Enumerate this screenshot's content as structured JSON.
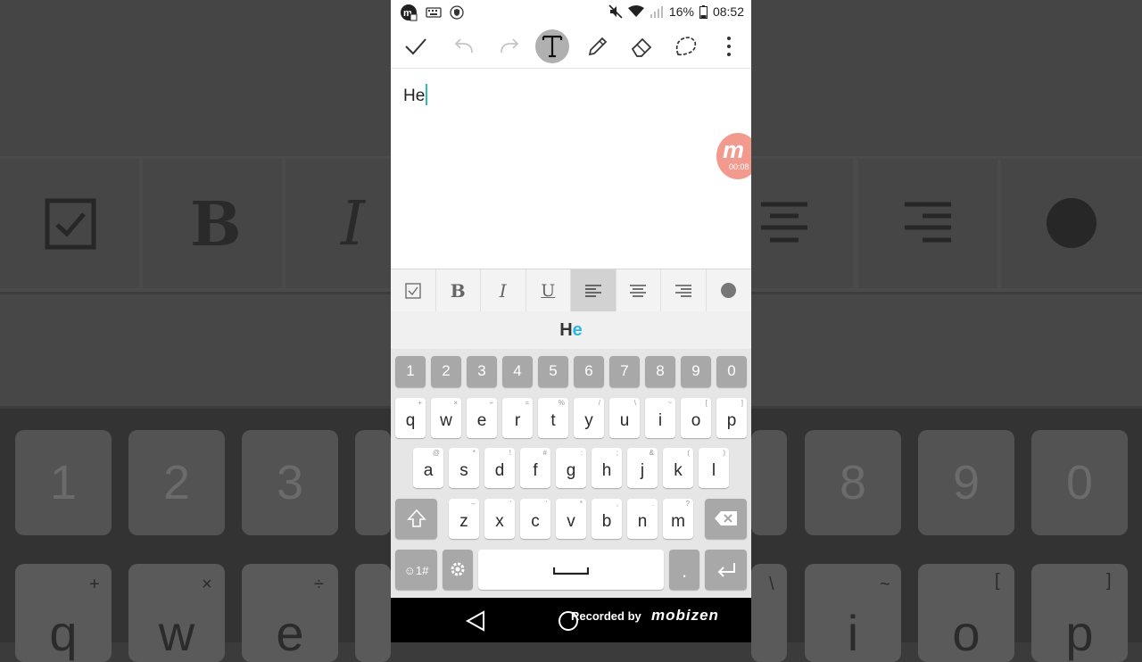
{
  "status_bar": {
    "battery": "16%",
    "time": "08:52"
  },
  "editor": {
    "text": "He"
  },
  "recorder_badge": {
    "logo_letter": "m",
    "timer": "00:08"
  },
  "format_bar": {
    "items": [
      "checkbox",
      "bold",
      "italic",
      "underline",
      "align-left",
      "align-center",
      "align-right",
      "color"
    ],
    "bold_label": "B",
    "italic_label": "I",
    "underline_label": "U",
    "selected": "align-left"
  },
  "suggestion": {
    "prefix": "H",
    "highlight": "e"
  },
  "keyboard": {
    "numbers": [
      "1",
      "2",
      "3",
      "4",
      "5",
      "6",
      "7",
      "8",
      "9",
      "0"
    ],
    "row1": [
      {
        "k": "q",
        "h": "+"
      },
      {
        "k": "w",
        "h": "×"
      },
      {
        "k": "e",
        "h": "÷"
      },
      {
        "k": "r",
        "h": "="
      },
      {
        "k": "t",
        "h": "%"
      },
      {
        "k": "y",
        "h": "/"
      },
      {
        "k": "u",
        "h": "\\"
      },
      {
        "k": "i",
        "h": "~"
      },
      {
        "k": "o",
        "h": "["
      },
      {
        "k": "p",
        "h": "]"
      }
    ],
    "row2": [
      {
        "k": "a",
        "h": "@"
      },
      {
        "k": "s",
        "h": "*"
      },
      {
        "k": "d",
        "h": "!"
      },
      {
        "k": "f",
        "h": "#"
      },
      {
        "k": "g",
        "h": ":"
      },
      {
        "k": "h",
        "h": ";"
      },
      {
        "k": "j",
        "h": "&"
      },
      {
        "k": "k",
        "h": "("
      },
      {
        "k": "l",
        "h": ")"
      }
    ],
    "row3": [
      {
        "k": "z",
        "h": "–"
      },
      {
        "k": "x",
        "h": "'"
      },
      {
        "k": "c",
        "h": "'"
      },
      {
        "k": "v",
        "h": "*"
      },
      {
        "k": "b",
        "h": ","
      },
      {
        "k": "n",
        "h": "."
      },
      {
        "k": "m",
        "h": "?"
      }
    ],
    "symbols_label": "☺1#",
    "period_label": "."
  },
  "nav_bar": {
    "recorded_by": "Recorded by",
    "brand": "mobizen"
  },
  "background": {
    "numbers": [
      "1",
      "2",
      "3",
      "8",
      "9",
      "0"
    ],
    "letters": [
      "q",
      "w",
      "e",
      "i",
      "o",
      "p"
    ],
    "hints": [
      "+",
      "×",
      "÷",
      "\\",
      "~",
      "[",
      "]"
    ],
    "bold_glyph": "B",
    "italic_glyph": "I"
  }
}
